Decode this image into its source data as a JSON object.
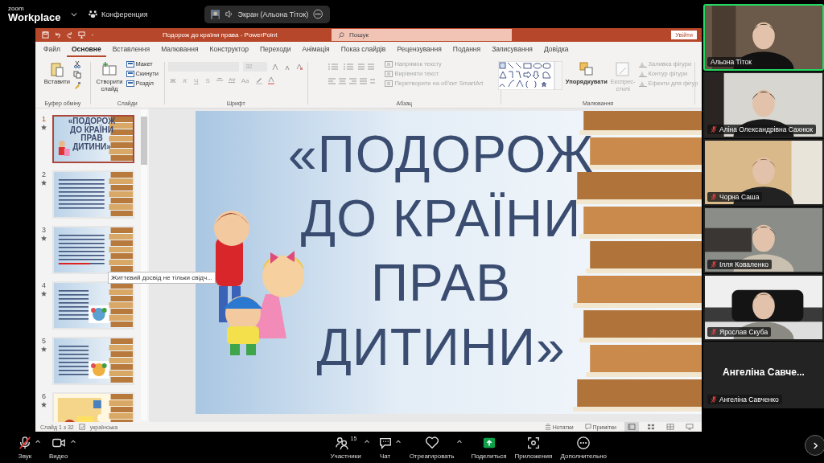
{
  "zoom_header": {
    "brand_small": "zoom",
    "brand": "Workplace",
    "meeting_label": "Конференция",
    "share_indicator": "Экран (Альона Тіток)"
  },
  "powerpoint": {
    "title": "Подорож до країни права  -  PowerPoint",
    "search_placeholder": "Пошук",
    "sign_in": "Увійти",
    "tabs": [
      {
        "label": "Файл",
        "selected": false
      },
      {
        "label": "Основне",
        "selected": true
      },
      {
        "label": "Вставлення",
        "selected": false
      },
      {
        "label": "Малювання",
        "selected": false
      },
      {
        "label": "Конструктор",
        "selected": false
      },
      {
        "label": "Переходи",
        "selected": false
      },
      {
        "label": "Анімація",
        "selected": false
      },
      {
        "label": "Показ слайдів",
        "selected": false
      },
      {
        "label": "Рецензування",
        "selected": false
      },
      {
        "label": "Подання",
        "selected": false
      },
      {
        "label": "Записування",
        "selected": false
      },
      {
        "label": "Довідка",
        "selected": false
      }
    ],
    "ribbon_groups": [
      {
        "kind": "clipboard",
        "label": "Буфер обміну",
        "paste": "Вставити"
      },
      {
        "kind": "slides",
        "label": "Слайди",
        "new_slide_lines": [
          "Створити",
          "слайд"
        ],
        "items": [
          "Макет",
          "Скинути",
          "Розділ"
        ]
      },
      {
        "kind": "font",
        "label": "Шрифт",
        "disabled": true,
        "size": "32",
        "format_buttons": [
          "Ж",
          "К",
          "Ч",
          "S"
        ],
        "case_button": "Aa"
      },
      {
        "kind": "paragraph",
        "label": "Абзац",
        "items": [
          {
            "label": "Напрямок тексту",
            "disabled": true
          },
          {
            "label": "Вирівняти текст",
            "disabled": true
          },
          {
            "label": "Перетворити на об'єкт SmartArt",
            "disabled": true
          }
        ]
      },
      {
        "kind": "drawing",
        "label": "Малювання",
        "arrange": "Упорядкувати",
        "quick_styles_lines": [
          "Експрес-",
          "стилі"
        ],
        "quick_styles_disabled": true,
        "items": [
          {
            "label": "Заливка фігури",
            "disabled": true
          },
          {
            "label": "Контур фігури",
            "disabled": true
          },
          {
            "label": "Ефекти для фігур",
            "disabled": true
          }
        ]
      }
    ],
    "thumbnails": [
      {
        "number": "1",
        "selected": true,
        "kind": "title",
        "title_lines": [
          "«ПОДОРОЖ",
          "ДО КРАЇНИ",
          "ПРАВ",
          "ДИТИНИ»"
        ]
      },
      {
        "number": "2",
        "selected": false,
        "kind": "text"
      },
      {
        "number": "3",
        "selected": false,
        "kind": "text"
      },
      {
        "number": "4",
        "selected": false,
        "kind": "text_picture"
      },
      {
        "number": "5",
        "selected": false,
        "kind": "text_picture"
      },
      {
        "number": "6",
        "selected": false,
        "kind": "puzzle"
      }
    ],
    "tooltip": "Життєвий досвід не тільки свідч...",
    "slide": {
      "title_lines": [
        "«ПОДОРОЖ",
        "ДО КРАЇНИ",
        "ПРАВ",
        "ДИТИНИ»"
      ]
    },
    "status_bar": {
      "slide_counter": "Слайд 1 з 32",
      "language": "українська",
      "notes": "Нотатки",
      "comments": "Примітки",
      "views": [
        {
          "kind": "normal",
          "selected": true
        },
        {
          "kind": "sorter",
          "selected": false
        },
        {
          "kind": "reading",
          "selected": false
        },
        {
          "kind": "slideshow",
          "selected": false
        }
      ]
    }
  },
  "participants": [
    {
      "name": "Альона Тіток",
      "muted": false,
      "active": true,
      "kind": "video"
    },
    {
      "name": "Аліна Олександрівна Сахнюк",
      "muted": true,
      "active": false,
      "kind": "video"
    },
    {
      "name": "Чорна Саша",
      "muted": true,
      "active": false,
      "kind": "video"
    },
    {
      "name": "Ілля Коваленко",
      "muted": true,
      "active": false,
      "kind": "video"
    },
    {
      "name": "Ярослав Скуба",
      "muted": true,
      "active": false,
      "kind": "video"
    },
    {
      "name": "Ангеліна Савченко",
      "muted": true,
      "active": false,
      "kind": "name_only",
      "display_name": "Ангеліна  Савче..."
    }
  ],
  "toolbar": [
    {
      "kind": "audio",
      "label": "Звук",
      "muted": true,
      "caret": true
    },
    {
      "kind": "video",
      "label": "Видео",
      "caret": true
    },
    {
      "kind": "participants",
      "label": "Участники",
      "count": "15",
      "caret": true
    },
    {
      "kind": "chat",
      "label": "Чат",
      "caret": true
    },
    {
      "kind": "react",
      "label": "Отреагировать",
      "caret": true
    },
    {
      "kind": "share",
      "label": "Поделиться",
      "caret": false
    },
    {
      "kind": "apps",
      "label": "Приложения",
      "caret": false
    },
    {
      "kind": "more",
      "label": "Дополнительно",
      "caret": false
    }
  ]
}
